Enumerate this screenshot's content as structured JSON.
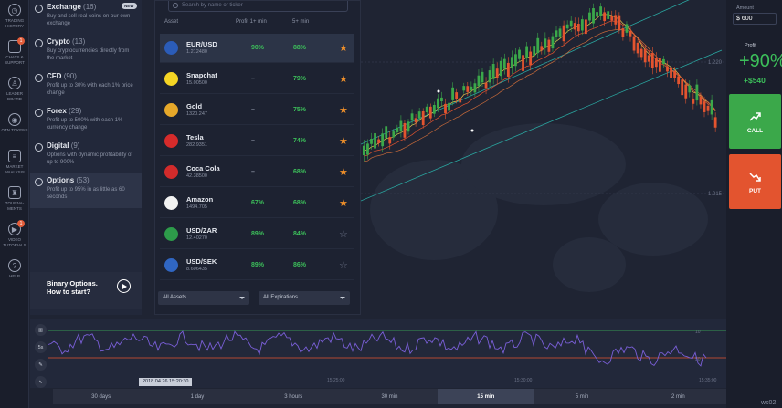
{
  "sidebar": {
    "items": [
      {
        "label": "TRADING HISTORY",
        "icon": "clock-icon"
      },
      {
        "label": "CHATS & SUPPORT",
        "icon": "chat-icon",
        "badge": "1"
      },
      {
        "label": "LEADER BOARD",
        "icon": "leaderboard-icon"
      },
      {
        "label": "OTN TOKENS",
        "icon": "token-icon"
      },
      {
        "label": "MARKET ANALYSIS",
        "icon": "analysis-icon"
      },
      {
        "label": "TOURNA-MENTS",
        "icon": "trophy-icon"
      },
      {
        "label": "VIDEO TUTORIALS",
        "icon": "video-icon",
        "badge": "1"
      },
      {
        "label": "HELP",
        "icon": "help-icon"
      }
    ]
  },
  "categories": [
    {
      "title": "Exchange",
      "count": "(16)",
      "desc": "Buy and sell real coins on our own exchange",
      "badge": "NEW"
    },
    {
      "title": "Crypto",
      "count": "(13)",
      "desc": "Buy cryptocurrencies directly from the market"
    },
    {
      "title": "CFD",
      "count": "(90)",
      "desc": "Profit up to 30% with each 1% price change"
    },
    {
      "title": "Forex",
      "count": "(29)",
      "desc": "Profit up to 500% with each 1% currency change"
    },
    {
      "title": "Digital",
      "count": "(9)",
      "desc": "Options with dynamic profitability of up to 900%"
    },
    {
      "title": "Options",
      "count": "(53)",
      "desc": "Profit up to 95% in as little as 60 seconds"
    }
  ],
  "promo": {
    "title": "Binary Options. How to start?"
  },
  "assets": {
    "search_placeholder": "Search by name or ticker",
    "headers": {
      "asset": "Asset",
      "profit1": "Profit 1+ min",
      "profit5": "5+ min"
    },
    "rows": [
      {
        "name": "EUR/USD",
        "price": "1.212480",
        "p1": "90%",
        "p5": "88%",
        "fav": true,
        "color": "#2b5cb8"
      },
      {
        "name": "Snapchat",
        "price": "15.00500",
        "p1": "–",
        "p5": "79%",
        "fav": true,
        "color": "#f5d524"
      },
      {
        "name": "Gold",
        "price": "1320.247",
        "p1": "–",
        "p5": "75%",
        "fav": true,
        "color": "#e6a82a"
      },
      {
        "name": "Tesla",
        "price": "282.9351",
        "p1": "–",
        "p5": "74%",
        "fav": true,
        "color": "#d62b2b"
      },
      {
        "name": "Coca Cola",
        "price": "42.38500",
        "p1": "–",
        "p5": "68%",
        "fav": true,
        "color": "#d22b2b"
      },
      {
        "name": "Amazon",
        "price": "1494.705",
        "p1": "67%",
        "p5": "68%",
        "fav": true,
        "color": "#f2f2f2"
      },
      {
        "name": "USD/ZAR",
        "price": "12.40270",
        "p1": "89%",
        "p5": "84%",
        "fav": false,
        "color": "#2d9b4a"
      },
      {
        "name": "USD/SEK",
        "price": "8.606435",
        "p1": "89%",
        "p5": "86%",
        "fav": false,
        "color": "#3066c2"
      }
    ],
    "filter_assets": "All Assets",
    "filter_expirations": "All Expirations"
  },
  "chart": {
    "price_label_1": "1.220",
    "price_label_2": "1.215",
    "ind_label_1": "10",
    "ind_label_2": "50"
  },
  "trade": {
    "amount_label": "Amount",
    "amount_value": "$ 600",
    "profit_label": "Profit",
    "profit_pct": "+90%",
    "profit_amt": "+$540",
    "call_label": "CALL",
    "put_label": "PUT"
  },
  "tools": [
    "5s"
  ],
  "timeline": {
    "date_tag": "2018.04.26 15:20:30",
    "ticks": [
      "15:25:00",
      "15:30:00",
      "15:35:00"
    ],
    "periods": [
      "30 days",
      "1 day",
      "3 hours",
      "30 min",
      "15 min",
      "5 min",
      "2 min"
    ],
    "selected": "15 min"
  },
  "watermark": "ws02"
}
